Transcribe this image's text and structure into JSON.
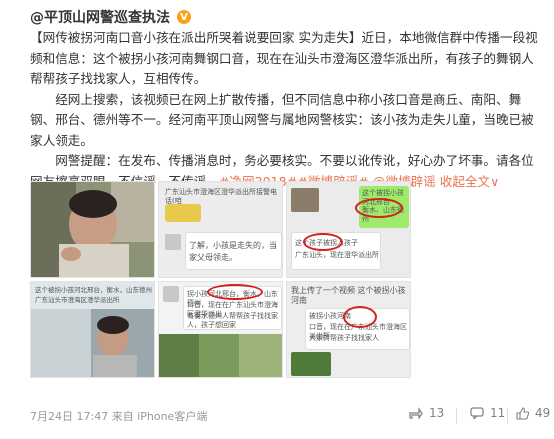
{
  "header": {
    "author": "@平顶山网警巡查执法"
  },
  "post": {
    "p1": "【网传被拐河南口音小孩在派出所哭着说要回家 实为走失】近日，本地微信群中传播一段视频和信息：这个被拐小孩河南舞钢口音，现在在汕头市澄海区澄华派出所，有孩子的舞钢人帮帮孩子找找家人，互相传传。",
    "p2": "经网上搜索，该视频已在网上扩散传播，但不同信息中称小孩口音是商丘、南阳、舞钢、邢台、德州等不一。经河南平顶山网警与属地网警核实：该小孩为走失儿童，当晚已被家人领走。",
    "p3": "网警提醒：在发布、传播消息时，务必要核实。不要以讹传讹，好心办了坏事。请各位网友擦亮双眼，不信谣，不传谣。",
    "tags": [
      "#净网2018#",
      "#微博辟谣#"
    ],
    "mention": "@微博辟谣",
    "expand": "收起全文",
    "expand_arrow": "∨"
  },
  "thumbs": {
    "t2_line1": "广东汕头市澄海区澄华派出所接警电话(咱",
    "t2_line2": "了解，小孩是走失的，当",
    "t2_line3": "家父母领走。",
    "t3_line1": "这个被拐小孩河北邢台",
    "t3_line2": "衡水、山东德州",
    "t3_line3": "这个孩子被拐人孩子",
    "t3_line4": "广东汕头，现在澄华派出所",
    "t4_line1": "这个被拐小孩河北邢台，衡水，山东德州",
    "t4_line2": "广东汕头市澄海区澄华派出所",
    "t5_line1": "拐小孩河北邢台，衡水，山东德州",
    "t5_line2": "口音，现在在广东汕头市澄海区澄华派出",
    "t5_line3": "有衡水德州人帮帮孩子找找家人，孩子想回家",
    "t6_line1": "我上传了一个视频 这个被拐小孩河南",
    "t6_line2": "被拐小孩河南",
    "t6_line3": "口音，现在在广东汕头市澄海区派出所",
    "t6_line4": "大家转帮孩子找找家人"
  },
  "footer": {
    "meta": "7月24日 17:47 来自 iPhone客户端"
  },
  "actions": {
    "share_count": "13",
    "comment_count": "11",
    "like_count": "49"
  },
  "colors": {
    "accent": "#eb7350",
    "verified": "#f7a21b",
    "text": "#333333",
    "muted": "#999999"
  }
}
